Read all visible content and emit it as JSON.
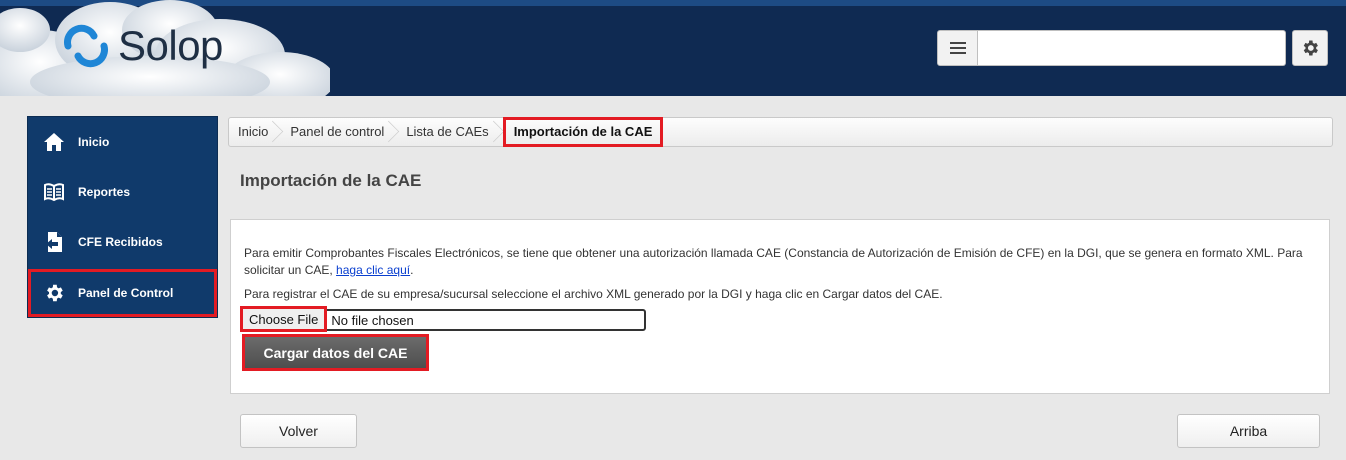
{
  "header": {
    "brand": "Solop",
    "search": {
      "value": "",
      "placeholder": ""
    },
    "icons": {
      "menu": "hamburger-menu-icon",
      "settings": "gear-icon"
    },
    "colors": {
      "header_bg": "#0f2a52",
      "sidebar_bg": "#103a6b",
      "highlight": "#e31b23"
    }
  },
  "sidebar": {
    "items": [
      {
        "label": "Inicio",
        "icon": "home-icon"
      },
      {
        "label": "Reportes",
        "icon": "book-icon"
      },
      {
        "label": "CFE Recibidos",
        "icon": "document-import-icon"
      },
      {
        "label": "Panel de Control",
        "icon": "gear-icon"
      }
    ]
  },
  "breadcrumb": [
    "Inicio",
    "Panel de control",
    "Lista de CAEs",
    "Importación de la CAE"
  ],
  "page": {
    "title": "Importación de la CAE",
    "paragraph1_text": "Para emitir Comprobantes Fiscales Electrónicos, se tiene que obtener una autorización llamada CAE (Constancia de Autorización de Emisión de CFE) en la DGI, que se genera en formato XML. Para solicitar un CAE, ",
    "paragraph1_link": "haga clic aquí",
    "paragraph1_end": ".",
    "paragraph2": "Para registrar el CAE de su empresa/sucursal seleccione el archivo XML generado por la DGI y haga clic en Cargar datos del CAE.",
    "file": {
      "button": "Choose File",
      "status": "No file chosen"
    },
    "submit": "Cargar datos del CAE"
  },
  "footer": {
    "back": "Volver",
    "top": "Arriba"
  }
}
